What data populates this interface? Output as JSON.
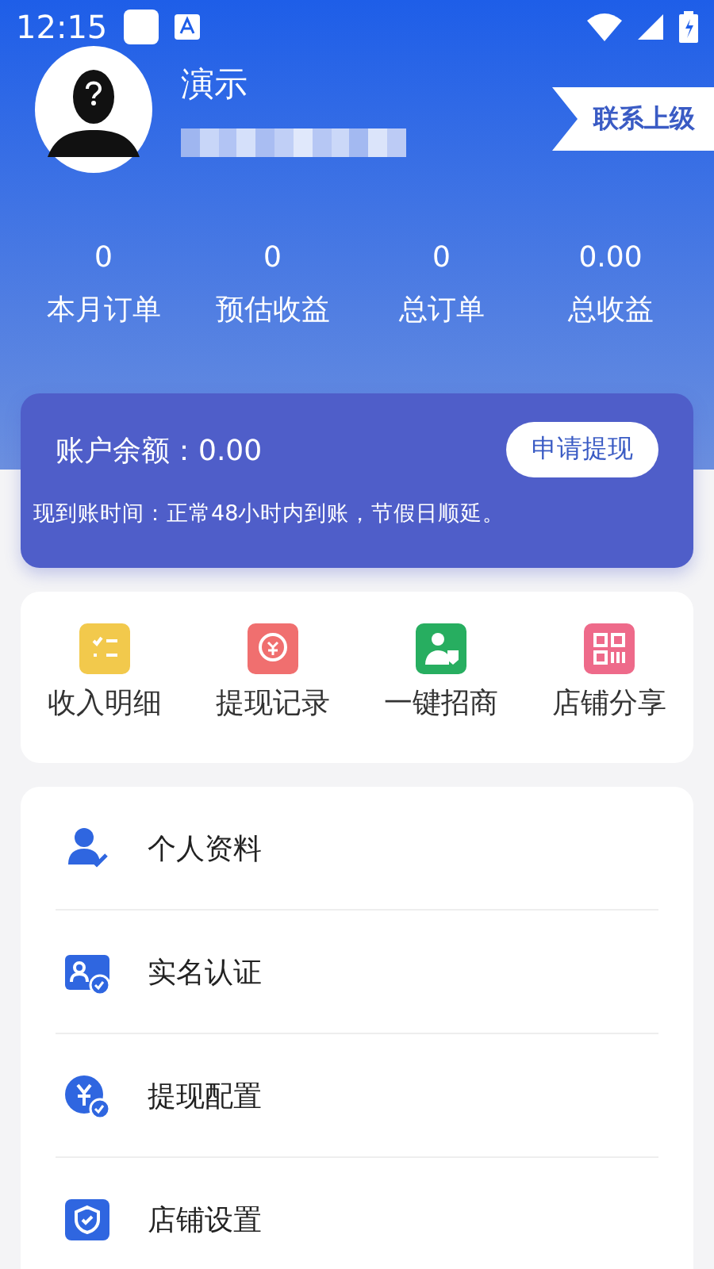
{
  "status_bar": {
    "time": "12:15"
  },
  "profile": {
    "name": "演示",
    "contact_button": "联系上级"
  },
  "stats": [
    {
      "value": "0",
      "label": "本月订单"
    },
    {
      "value": "0",
      "label": "预估收益"
    },
    {
      "value": "0",
      "label": "总订单"
    },
    {
      "value": "0.00",
      "label": "总收益"
    }
  ],
  "balance": {
    "label": "账户余额：0.00",
    "button": "申请提现",
    "note": "现到账时间：正常48小时内到账，节假日顺延。"
  },
  "shortcuts": [
    {
      "kind": "list",
      "label": "收入明细",
      "color": "#f2c94c"
    },
    {
      "kind": "coin",
      "label": "提现记录",
      "color": "#f06f6f"
    },
    {
      "kind": "person",
      "label": "一键招商",
      "color": "#27ae60"
    },
    {
      "kind": "grid",
      "label": "店铺分享",
      "color": "#ee6a8a"
    }
  ],
  "menu": [
    {
      "kind": "user",
      "label": "个人资料"
    },
    {
      "kind": "idcard",
      "label": "实名认证"
    },
    {
      "kind": "yuan",
      "label": "提现配置"
    },
    {
      "kind": "shield",
      "label": "店铺设置"
    }
  ]
}
